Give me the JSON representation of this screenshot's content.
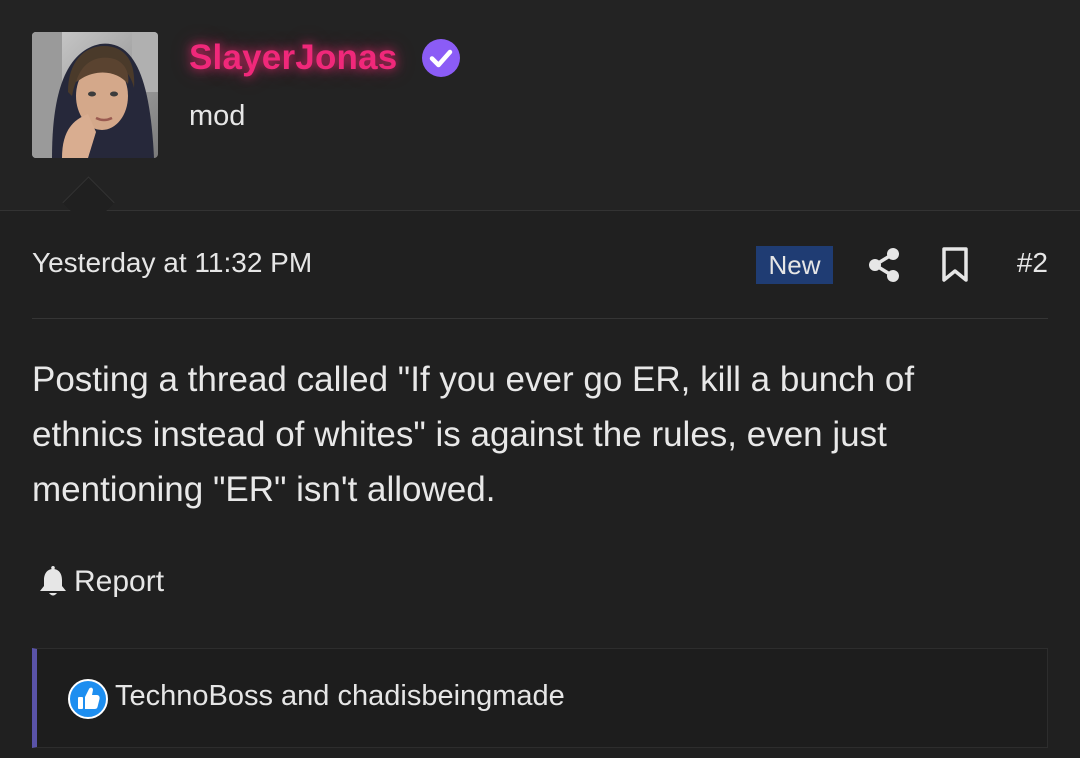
{
  "post": {
    "author": {
      "username": "SlayerJonas",
      "role": "mod",
      "avatar_icon": "user-avatar-photo",
      "verified_icon": "verified-badge-icon",
      "username_color": "#f0287a",
      "verified_color": "#8b5cf6"
    },
    "timestamp": "Yesterday at 11:32 PM",
    "badge": "New",
    "badge_color": "#1f3c73",
    "share_icon": "share-icon",
    "bookmark_icon": "bookmark-icon",
    "post_number": "#2",
    "body": "Posting a thread called \"If you ever go ER, kill a bunch of ethnics instead of whites\" is against the rules, even just mentioning \"ER\" isn't allowed.",
    "report": {
      "icon": "bell-icon",
      "label": "Report"
    },
    "reactions": {
      "icon": "like-icon",
      "icon_color": "#1d8ef0",
      "text": "TechnoBoss and chadisbeingmade",
      "accent_color": "#5a53a8"
    }
  }
}
